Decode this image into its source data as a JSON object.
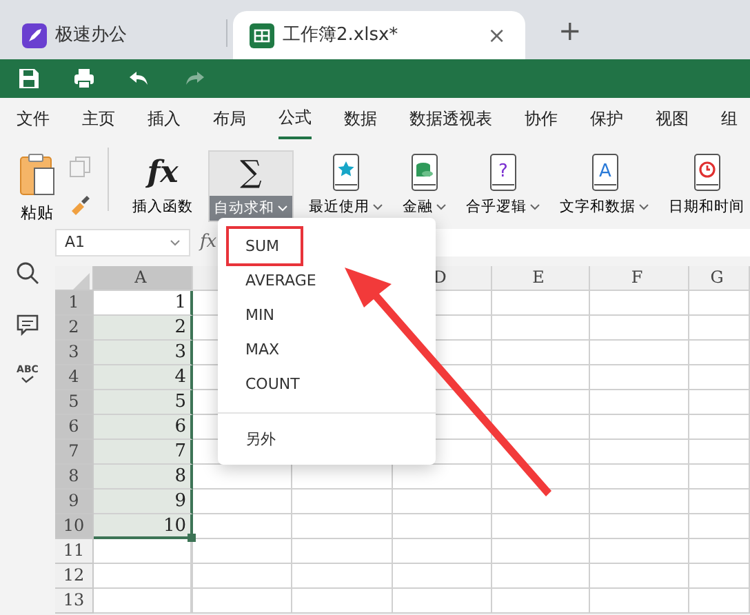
{
  "app_tabs": [
    {
      "label": "极速办公",
      "kind": "home",
      "selected": false
    },
    {
      "label": "工作簿2.xlsx*",
      "kind": "sheet",
      "selected": true,
      "close": "×"
    }
  ],
  "new_tab": "+",
  "quick_access": [
    {
      "kind": "save",
      "disabled": false
    },
    {
      "kind": "print",
      "disabled": false
    },
    {
      "kind": "undo",
      "disabled": false
    },
    {
      "kind": "redo",
      "disabled": true
    }
  ],
  "menu": [
    {
      "label": "文件",
      "selected": false
    },
    {
      "label": "主页",
      "selected": false
    },
    {
      "label": "插入",
      "selected": false
    },
    {
      "label": "布局",
      "selected": false
    },
    {
      "label": "公式",
      "selected": true
    },
    {
      "label": "数据",
      "selected": false
    },
    {
      "label": "数据透视表",
      "selected": false
    },
    {
      "label": "协作",
      "selected": false
    },
    {
      "label": "保护",
      "selected": false
    },
    {
      "label": "视图",
      "selected": false
    },
    {
      "label": "组",
      "selected": false
    }
  ],
  "clipboard": {
    "paste": "粘贴"
  },
  "functions": [
    {
      "label": "插入函数",
      "kind": "fx",
      "symbol": "fx",
      "dropdown": false,
      "selected": false
    },
    {
      "label": "自动求和",
      "kind": "sum",
      "symbol": "∑",
      "dropdown": true,
      "selected": true
    },
    {
      "label": "最近使用",
      "kind": "recent",
      "dropdown": true,
      "selected": false
    },
    {
      "label": "金融",
      "kind": "finance",
      "dropdown": true,
      "selected": false
    },
    {
      "label": "合乎逻辑",
      "kind": "logic",
      "glyph": "?",
      "dropdown": true,
      "selected": false
    },
    {
      "label": "文字和数据",
      "kind": "text",
      "glyph": "A",
      "dropdown": true,
      "selected": false
    },
    {
      "label": "日期和时间",
      "kind": "date",
      "dropdown": false,
      "selected": false
    }
  ],
  "sidebar": [
    {
      "kind": "search"
    },
    {
      "kind": "comment"
    },
    {
      "kind": "spellcheck",
      "label": "ABC"
    }
  ],
  "name_box": "A1",
  "formula_label": "fx",
  "columns": [
    {
      "label": "A",
      "selected": true
    },
    {
      "label": "D",
      "selected": false
    },
    {
      "label": "E",
      "selected": false
    },
    {
      "label": "F",
      "selected": false
    },
    {
      "label": "G",
      "selected": false
    }
  ],
  "rows": [
    {
      "header": "1",
      "selected": true,
      "value": "1",
      "highlighted": false
    },
    {
      "header": "2",
      "selected": true,
      "value": "2",
      "highlighted": true
    },
    {
      "header": "3",
      "selected": true,
      "value": "3",
      "highlighted": true
    },
    {
      "header": "4",
      "selected": true,
      "value": "4",
      "highlighted": true
    },
    {
      "header": "5",
      "selected": true,
      "value": "5",
      "highlighted": true
    },
    {
      "header": "6",
      "selected": true,
      "value": "6",
      "highlighted": true
    },
    {
      "header": "7",
      "selected": true,
      "value": "7",
      "highlighted": true
    },
    {
      "header": "8",
      "selected": true,
      "value": "8",
      "highlighted": true
    },
    {
      "header": "9",
      "selected": true,
      "value": "9",
      "highlighted": true
    },
    {
      "header": "10",
      "selected": true,
      "value": "10",
      "highlighted": true
    },
    {
      "header": "11",
      "selected": false,
      "highlighted": false
    },
    {
      "header": "12",
      "selected": false,
      "highlighted": false
    },
    {
      "header": "13",
      "selected": false,
      "highlighted": false
    }
  ],
  "dropdown": [
    {
      "label": "SUM",
      "kind": "function",
      "highlighted": true
    },
    {
      "label": "AVERAGE",
      "kind": "function",
      "highlighted": false
    },
    {
      "label": "MIN",
      "kind": "function",
      "highlighted": false
    },
    {
      "label": "MAX",
      "kind": "function",
      "highlighted": false
    },
    {
      "label": "COUNT",
      "kind": "function",
      "highlighted": false
    },
    {
      "label": "另外",
      "kind": "more",
      "highlighted": false
    }
  ]
}
